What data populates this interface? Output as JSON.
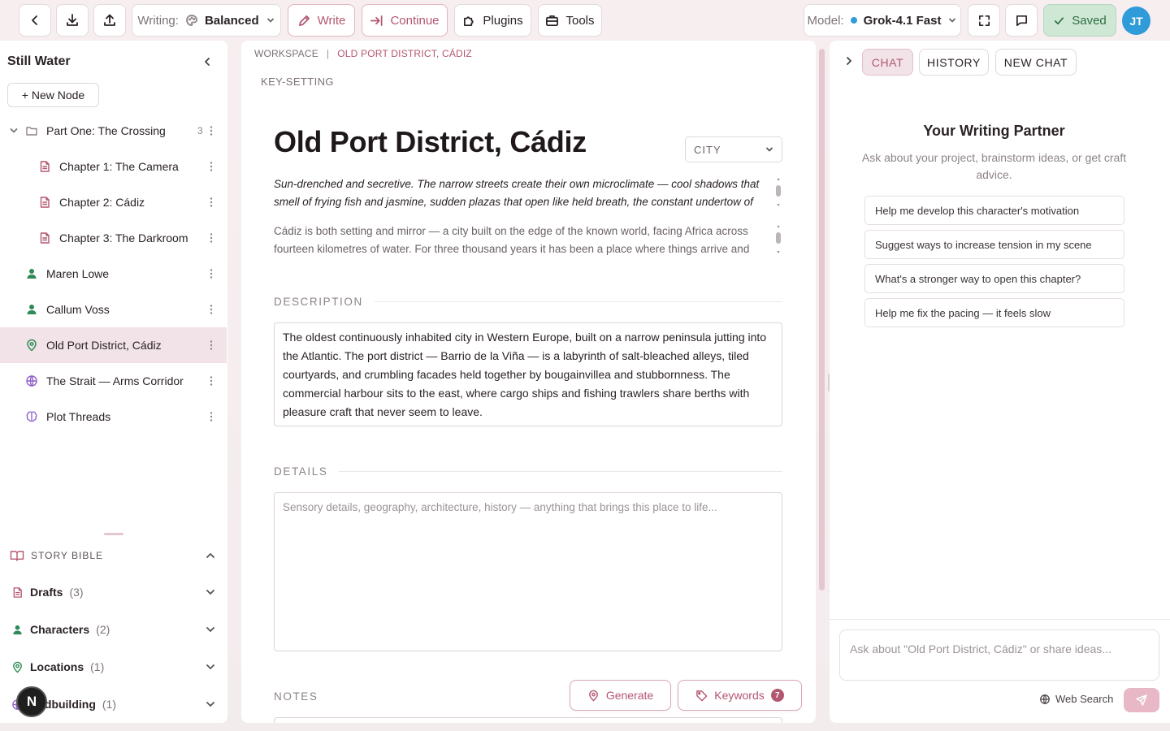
{
  "topbar": {
    "writing_label": "Writing:",
    "writing_mode": "Balanced",
    "write_label": "Write",
    "continue_label": "Continue",
    "plugins_label": "Plugins",
    "tools_label": "Tools",
    "model_label": "Model:",
    "model_name": "Grok-4.1 Fast",
    "saved_label": "Saved",
    "avatar_initials": "JT"
  },
  "sidebar": {
    "project_title": "Still Water",
    "new_node_label": "+ New Node",
    "tree": [
      {
        "label": "Part One: The Crossing",
        "count": "3",
        "icon": "folder-icon"
      },
      {
        "label": "Chapter 1: The Camera",
        "icon": "document-icon"
      },
      {
        "label": "Chapter 2: Cádiz",
        "icon": "document-icon"
      },
      {
        "label": "Chapter 3: The Darkroom",
        "icon": "document-icon"
      },
      {
        "label": "Maren Lowe",
        "icon": "person-icon"
      },
      {
        "label": "Callum Voss",
        "icon": "person-icon"
      },
      {
        "label": "Old Port District, Cádiz",
        "icon": "location-pin-icon",
        "active": true
      },
      {
        "label": "The Strait — Arms Corridor",
        "icon": "globe-icon"
      },
      {
        "label": "Plot Threads",
        "icon": "brain-icon"
      }
    ],
    "story_bible": {
      "heading": "STORY BIBLE",
      "sections": [
        {
          "label": "Drafts",
          "count": "(3)"
        },
        {
          "label": "Characters",
          "count": "(2)"
        },
        {
          "label": "Locations",
          "count": "(1)"
        },
        {
          "label": "orldbuilding",
          "count": "(1)"
        }
      ]
    },
    "fab_label": "N"
  },
  "editor": {
    "breadcrumb_root": "WORKSPACE",
    "breadcrumb_sep": "|",
    "breadcrumb_current": "OLD PORT DISTRICT, CÁDIZ",
    "key_setting": "KEY-SETTING",
    "title": "Old Port District, Cádiz",
    "type_value": "CITY",
    "tagline_lines": [
      "Sun-drenched and secretive. The narrow streets create their own microclimate — cool shadows that",
      "smell of frying fish and jasmine, sudden plazas that open like held breath, the constant undertow of"
    ],
    "summary_lines": [
      "Cádiz is both setting and mirror — a city built on the edge of the known world, facing Africa across",
      "fourteen kilometres of water. For three thousand years it has been a place where things arrive and"
    ],
    "description_label": "DESCRIPTION",
    "description_lines": [
      "The oldest continuously inhabited city in Western Europe, built on a narrow peninsula jutting into",
      "the Atlantic. The port district — Barrio de la Viña — is a labyrinth of salt-bleached alleys, tiled",
      "courtyards, and crumbling facades held together by bougainvillea and stubbornness. The",
      "commercial harbour sits to the east, where cargo ships and fishing trawlers share berths with",
      "pleasure craft that never seem to leave."
    ],
    "details_label": "DETAILS",
    "details_placeholder": "Sensory details, geography, architecture, history — anything that brings this place to life...",
    "notes_label": "NOTES",
    "generate_label": "Generate",
    "keywords_label": "Keywords",
    "keywords_count": "7"
  },
  "chat": {
    "tabs": [
      "CHAT",
      "HISTORY",
      "NEW CHAT"
    ],
    "active_tab": "CHAT",
    "partner_title": "Your Writing Partner",
    "partner_subtitle": "Ask about your project, brainstorm ideas, or get craft advice.",
    "suggestions": [
      "Help me develop this character's motivation",
      "Suggest ways to increase tension in my scene",
      "What's a stronger way to open this chapter?",
      "Help me fix the pacing — it feels slow"
    ],
    "input_placeholder": "Ask about \"Old Port District, Cádiz\" or share ideas...",
    "web_search_label": "Web Search"
  },
  "colors": {
    "accent": "#b3566f",
    "saved_bg": "#cfe8d6",
    "person_icon": "#2e8b57",
    "avatar": "#2f9bd8"
  }
}
